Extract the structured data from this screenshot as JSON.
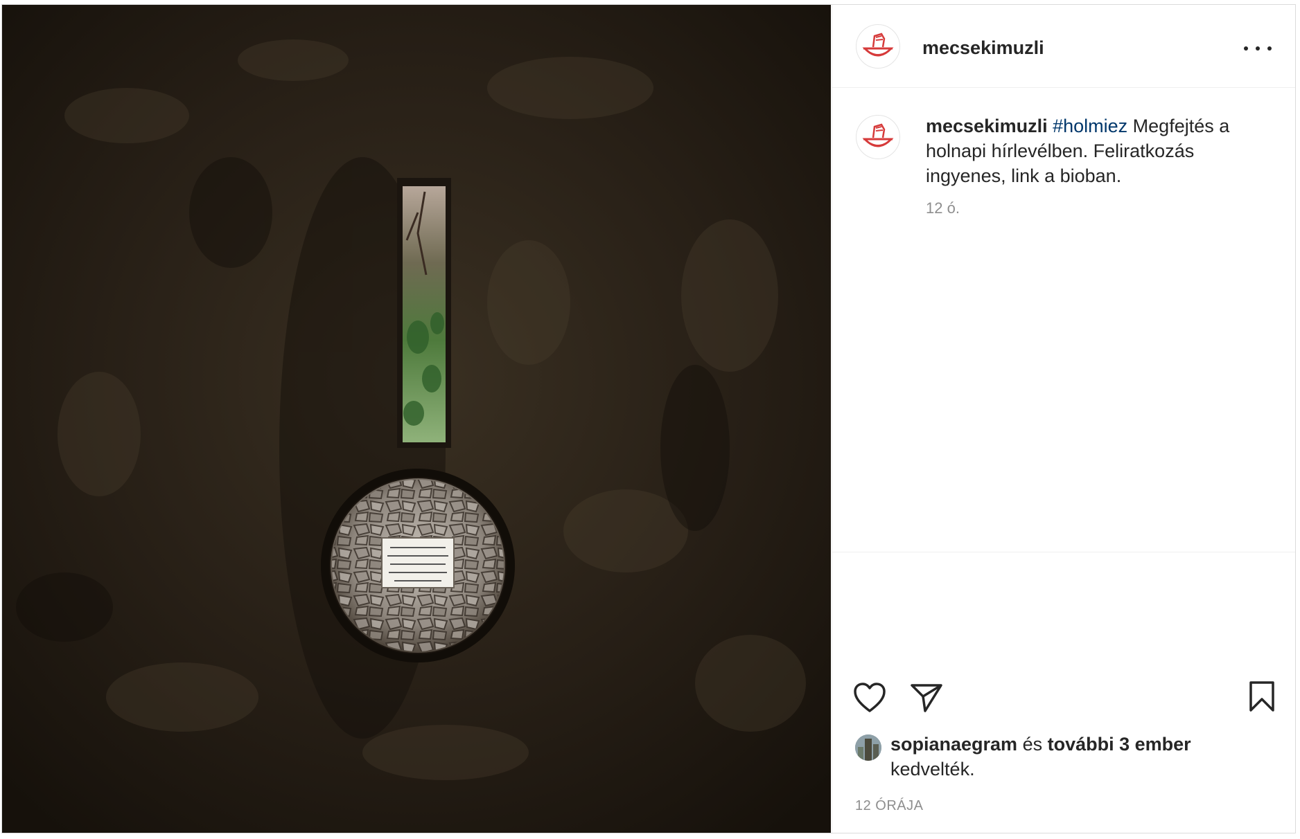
{
  "post": {
    "username": "mecsekimuzli",
    "avatar_icon": "bowl-fist-logo-icon",
    "more_icon": "more-options-icon"
  },
  "caption": {
    "username": "mecsekimuzli",
    "hashtag": "#holmiez",
    "text": " Megfejtés a holnapi hírlevélben. Feliratkozás ingyenes, link a bioban.",
    "time": "12 ó."
  },
  "actions": {
    "like_icon": "heart-icon",
    "share_icon": "paper-plane-icon",
    "save_icon": "bookmark-icon"
  },
  "likes": {
    "first_user": "sopianaegram",
    "connector": " és ",
    "others": "további 3 ember",
    "suffix": " kedvelték."
  },
  "timestamp": "12 ÓRÁJA",
  "colors": {
    "brand_red": "#d63a3a",
    "hashtag": "#00376b",
    "muted": "#8e8e8e"
  }
}
